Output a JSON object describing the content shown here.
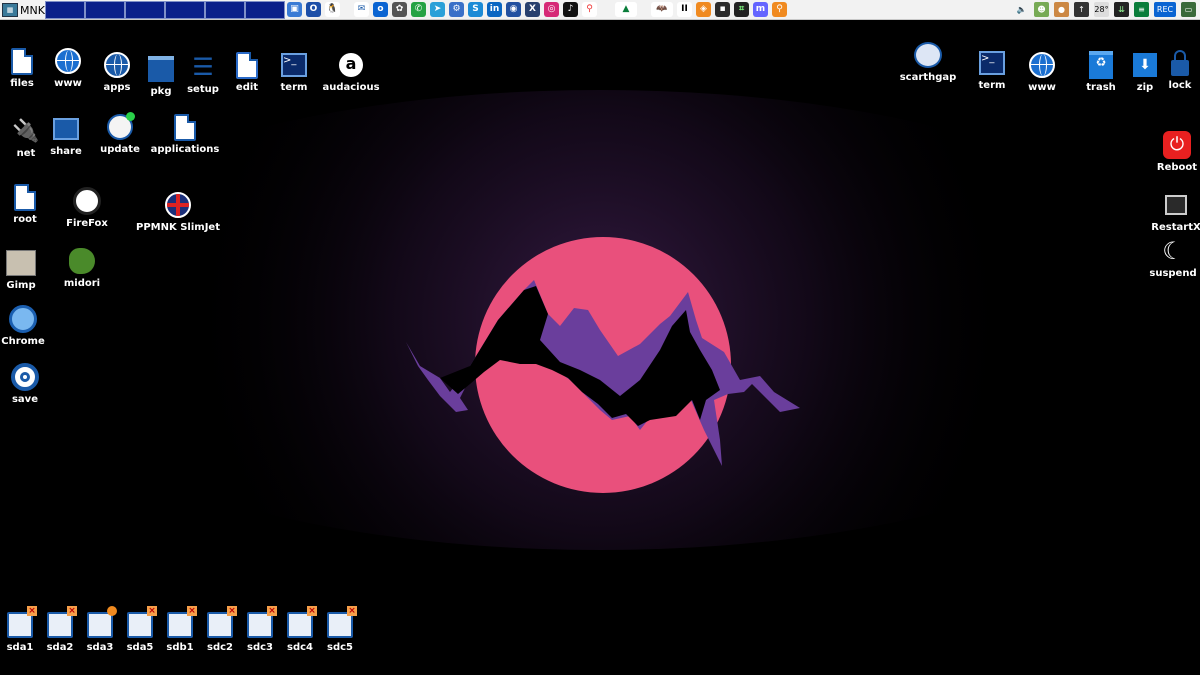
{
  "taskbar": {
    "menu_label": "MNK",
    "workspaces": 6,
    "tray_icons": [
      "desktop-icon",
      "opera-icon",
      "tux-icon",
      "mail-icon",
      "outlook-icon",
      "steam-icon",
      "whatsapp-icon",
      "telegram-icon",
      "settings-icon",
      "skype-icon",
      "linkedin-icon",
      "globe-icon",
      "x-icon",
      "instagram-icon",
      "tiktok-icon",
      "maps-icon",
      "mountain-icon",
      "batman-icon",
      "text-icon",
      "launcher-icon",
      "purple-icon",
      "terminal-icon",
      "mastodon-icon",
      "location-icon"
    ],
    "status": {
      "temp": "28°",
      "rec": "REC"
    }
  },
  "desktop_left": [
    {
      "name": "files",
      "label": "files",
      "icon": "file-icon"
    },
    {
      "name": "www",
      "label": "www",
      "icon": "globe-icon"
    },
    {
      "name": "apps",
      "label": "apps",
      "icon": "grid-globe-icon"
    },
    {
      "name": "pkg",
      "label": "pkg",
      "icon": "package-icon"
    },
    {
      "name": "setup",
      "label": "setup",
      "icon": "sliders-icon"
    },
    {
      "name": "edit",
      "label": "edit",
      "icon": "edit-icon"
    },
    {
      "name": "term",
      "label": "term",
      "icon": "terminal-icon"
    },
    {
      "name": "audacious",
      "label": "audacious",
      "icon": "audacious-icon"
    },
    {
      "name": "net",
      "label": "net",
      "icon": "network-icon"
    },
    {
      "name": "share",
      "label": "share",
      "icon": "share-icon"
    },
    {
      "name": "update",
      "label": "update",
      "icon": "update-icon"
    },
    {
      "name": "applications",
      "label": "applications",
      "icon": "file-icon"
    },
    {
      "name": "root",
      "label": "root",
      "icon": "file-icon"
    },
    {
      "name": "firefox",
      "label": "FireFox",
      "icon": "firefox-icon"
    },
    {
      "name": "slimjet",
      "label": "PPMNK SlimJet",
      "icon": "uk-flag-icon"
    },
    {
      "name": "gimp",
      "label": "Gimp",
      "icon": "gimp-icon"
    },
    {
      "name": "midori",
      "label": "midori",
      "icon": "midori-icon"
    },
    {
      "name": "chrome",
      "label": "Chrome",
      "icon": "chrome-icon"
    },
    {
      "name": "save",
      "label": "save",
      "icon": "save-icon"
    }
  ],
  "desktop_right": [
    {
      "name": "scarthgap",
      "label": "scarthgap",
      "icon": "puppy-icon"
    },
    {
      "name": "term2",
      "label": "term",
      "icon": "terminal-icon"
    },
    {
      "name": "www2",
      "label": "www",
      "icon": "globe-icon"
    },
    {
      "name": "trash",
      "label": "trash",
      "icon": "trash-icon"
    },
    {
      "name": "zip",
      "label": "zip",
      "icon": "zip-icon"
    },
    {
      "name": "lock",
      "label": "lock",
      "icon": "lock-icon"
    },
    {
      "name": "reboot",
      "label": "Reboot",
      "icon": "power-icon"
    },
    {
      "name": "restartx",
      "label": "RestartX",
      "icon": "restartx-icon"
    },
    {
      "name": "suspend",
      "label": "suspend",
      "icon": "moon-icon"
    }
  ],
  "drives": [
    "sda1",
    "sda2",
    "sda3",
    "sda5",
    "sdb1",
    "sdc2",
    "sdc3",
    "sdc4",
    "sdc5"
  ],
  "colors": {
    "sun": "#e9507c",
    "mountain": "#6a3e9c",
    "taskbar": "#f2f2f2",
    "workspace": "#0a1f8a"
  }
}
